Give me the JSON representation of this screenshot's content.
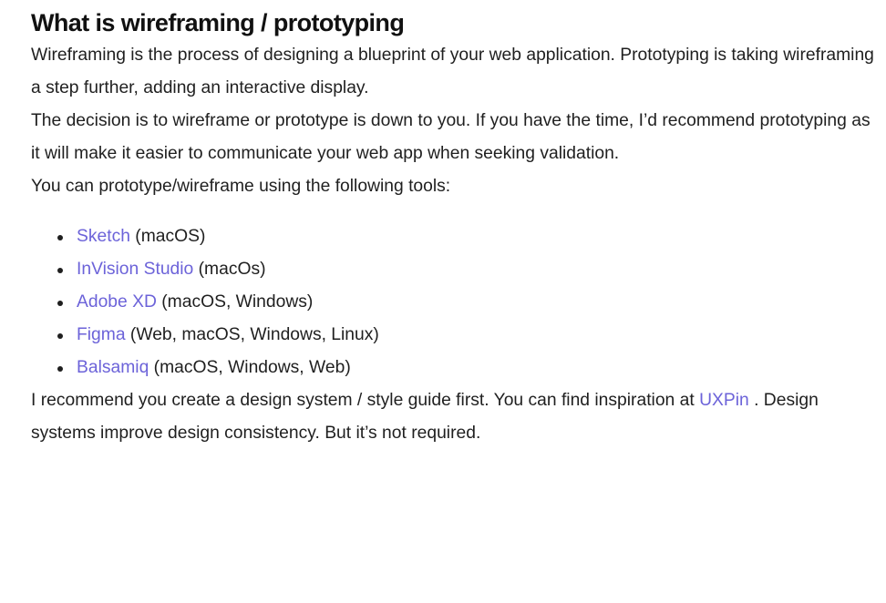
{
  "heading": "What is wireframing / prototyping",
  "paragraphs": {
    "intro": "Wireframing is the process of designing a blueprint of your web application. Prototyping is taking wireframing a step further, adding an interactive display.",
    "decision": "The decision is to wireframe or prototype is down to you. If you have the time, I’d recommend prototyping as it will make it easier to communicate your web app when seeking validation.",
    "tools_intro": "You can prototype/wireframe using the following tools:",
    "recommend_before": "I recommend you create a design system / style guide first. You can find inspiration at ",
    "recommend_link": "UXPin",
    "recommend_after": " . Design systems improve design consistency. But it’s not required."
  },
  "tools": [
    {
      "name": "Sketch",
      "platforms": " (macOS)"
    },
    {
      "name": "InVision Studio",
      "platforms": " (macOs)"
    },
    {
      "name": "Adobe XD",
      "platforms": " (macOS, Windows)"
    },
    {
      "name": "Figma",
      "platforms": " (Web, macOS, Windows, Linux)"
    },
    {
      "name": "Balsamiq",
      "platforms": " (macOS, Windows, Web)"
    }
  ],
  "colors": {
    "link": "#6c63d9",
    "text": "#1f1f1f",
    "heading": "#111111",
    "background": "#ffffff"
  }
}
